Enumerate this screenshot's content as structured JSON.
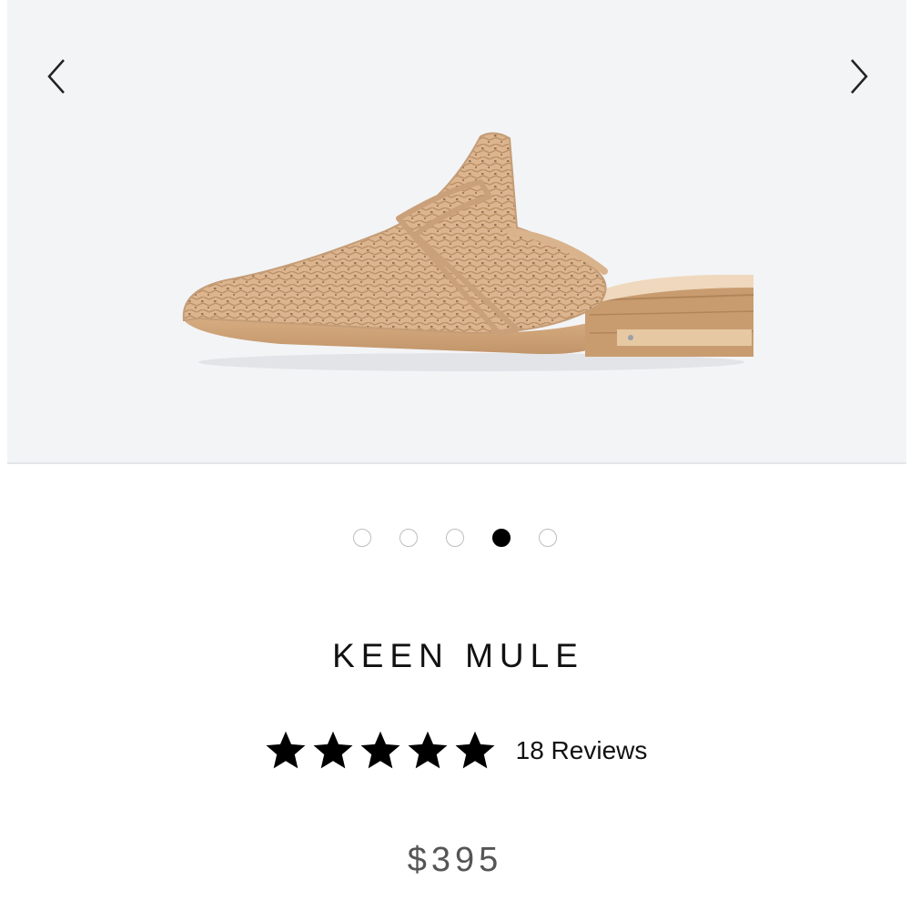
{
  "gallery": {
    "prev_icon": "chevron-left-icon",
    "next_icon": "chevron-right-icon",
    "image_description": "woven tan leather mule shoe",
    "slide_count": 5,
    "active_slide_index": 3
  },
  "product": {
    "name": "KEEN MULE",
    "rating": 5,
    "rating_max": 5,
    "reviews_label": "18 Reviews",
    "price": "$395"
  },
  "colors": {
    "gallery_background": "#f3f4f6",
    "leather": "#dcb48e",
    "sole": "#c99c70",
    "active_dot": "#000000",
    "inactive_dot_border": "#bdbdbd",
    "star": "#000000",
    "price_text": "#555555"
  }
}
